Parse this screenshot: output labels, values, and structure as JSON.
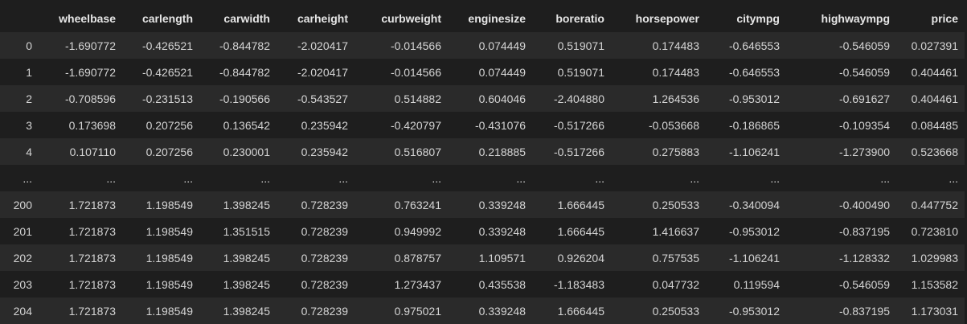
{
  "table": {
    "columns": [
      "",
      "wheelbase",
      "carlength",
      "carwidth",
      "carheight",
      "curbweight",
      "enginesize",
      "boreratio",
      "horsepower",
      "citympg",
      "highwaympg",
      "price"
    ],
    "rows": [
      [
        "0",
        "-1.690772",
        "-0.426521",
        "-0.844782",
        "-2.020417",
        "-0.014566",
        "0.074449",
        "0.519071",
        "0.174483",
        "-0.646553",
        "-0.546059",
        "0.027391"
      ],
      [
        "1",
        "-1.690772",
        "-0.426521",
        "-0.844782",
        "-2.020417",
        "-0.014566",
        "0.074449",
        "0.519071",
        "0.174483",
        "-0.646553",
        "-0.546059",
        "0.404461"
      ],
      [
        "2",
        "-0.708596",
        "-0.231513",
        "-0.190566",
        "-0.543527",
        "0.514882",
        "0.604046",
        "-2.404880",
        "1.264536",
        "-0.953012",
        "-0.691627",
        "0.404461"
      ],
      [
        "3",
        "0.173698",
        "0.207256",
        "0.136542",
        "0.235942",
        "-0.420797",
        "-0.431076",
        "-0.517266",
        "-0.053668",
        "-0.186865",
        "-0.109354",
        "0.084485"
      ],
      [
        "4",
        "0.107110",
        "0.207256",
        "0.230001",
        "0.235942",
        "0.516807",
        "0.218885",
        "-0.517266",
        "0.275883",
        "-1.106241",
        "-1.273900",
        "0.523668"
      ],
      [
        "...",
        "...",
        "...",
        "...",
        "...",
        "...",
        "...",
        "...",
        "...",
        "...",
        "...",
        "..."
      ],
      [
        "200",
        "1.721873",
        "1.198549",
        "1.398245",
        "0.728239",
        "0.763241",
        "0.339248",
        "1.666445",
        "0.250533",
        "-0.340094",
        "-0.400490",
        "0.447752"
      ],
      [
        "201",
        "1.721873",
        "1.198549",
        "1.351515",
        "0.728239",
        "0.949992",
        "0.339248",
        "1.666445",
        "1.416637",
        "-0.953012",
        "-0.837195",
        "0.723810"
      ],
      [
        "202",
        "1.721873",
        "1.198549",
        "1.398245",
        "0.728239",
        "0.878757",
        "1.109571",
        "0.926204",
        "0.757535",
        "-1.106241",
        "-1.128332",
        "1.029983"
      ],
      [
        "203",
        "1.721873",
        "1.198549",
        "1.398245",
        "0.728239",
        "1.273437",
        "0.435538",
        "-1.183483",
        "0.047732",
        "0.119594",
        "-0.546059",
        "1.153582"
      ],
      [
        "204",
        "1.721873",
        "1.198549",
        "1.398245",
        "0.728239",
        "0.975021",
        "0.339248",
        "1.666445",
        "0.250533",
        "-0.953012",
        "-0.837195",
        "1.173031"
      ]
    ]
  }
}
